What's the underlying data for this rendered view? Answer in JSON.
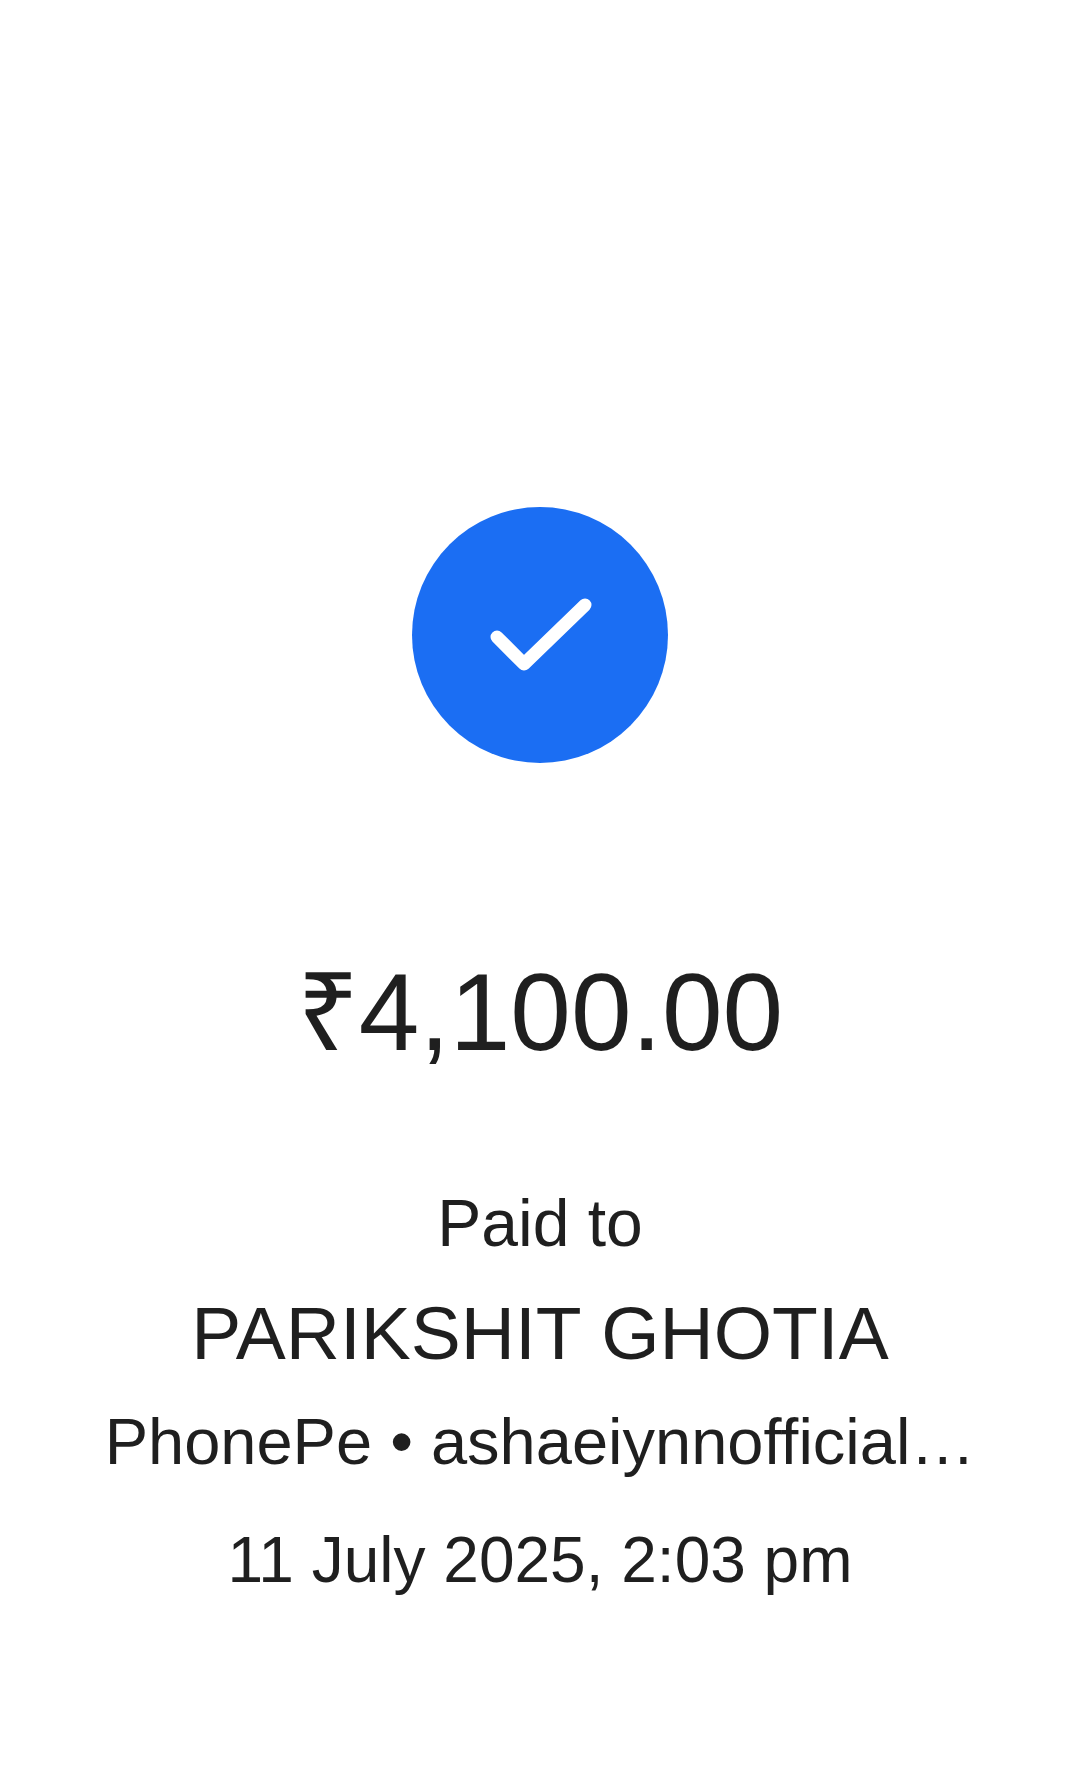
{
  "status_icon": {
    "kind": "success"
  },
  "amount": "₹4,100.00",
  "paid_to_label": "Paid to",
  "payee_name": "PARIKSHIT GHOTIA",
  "payee_details": "PhonePe • ashaeiynnofficial…",
  "timestamp": "11 July 2025, 2:03 pm"
}
